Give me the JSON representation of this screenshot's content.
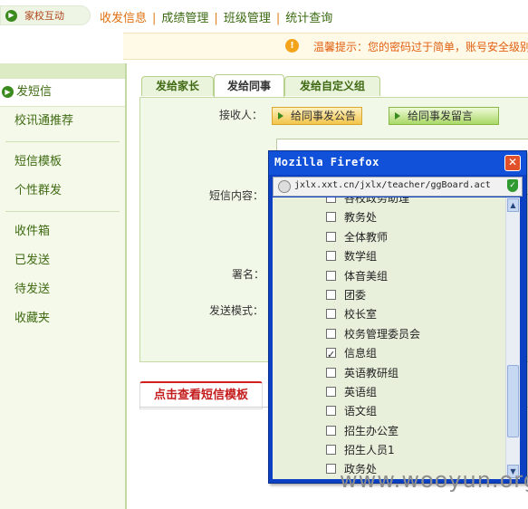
{
  "brand": {
    "label": "家校互动"
  },
  "topnav": [
    {
      "label": "收发信息",
      "active": true
    },
    {
      "label": "成绩管理",
      "active": false
    },
    {
      "label": "班级管理",
      "active": false
    },
    {
      "label": "统计查询",
      "active": false
    }
  ],
  "warning": {
    "text": "温馨提示：您的密码过于简单，账号安全级别"
  },
  "sidebar": {
    "items": [
      {
        "label": "发短信",
        "active": true
      },
      {
        "label": "校讯通推荐"
      },
      {
        "label": "短信模板"
      },
      {
        "label": "个性群发"
      },
      {
        "label": "收件箱"
      },
      {
        "label": "已发送"
      },
      {
        "label": "待发送"
      },
      {
        "label": "收藏夹"
      }
    ]
  },
  "tabs": [
    {
      "label": "发给家长"
    },
    {
      "label": "发给同事",
      "active": true
    },
    {
      "label": "发给自定义组"
    }
  ],
  "form": {
    "recipient_label": "接收人：",
    "btn_notice": "给同事发公告",
    "btn_message": "给同事发留言",
    "content_label": "短信内容：",
    "signature_label": "署名：",
    "send_mode_label": "发送模式："
  },
  "show_template_button": "点击查看短信模板",
  "popup": {
    "title": "Mozilla Firefox",
    "url": "jxlx.xxt.cn/jxlx/teacher/ggBoard.act",
    "items": [
      {
        "label": "各校政务助理",
        "checked": false
      },
      {
        "label": "教务处",
        "checked": false
      },
      {
        "label": "全体教师",
        "checked": false
      },
      {
        "label": "数学组",
        "checked": false
      },
      {
        "label": "体音美组",
        "checked": false
      },
      {
        "label": "团委",
        "checked": false
      },
      {
        "label": "校长室",
        "checked": false
      },
      {
        "label": "校务管理委员会",
        "checked": false
      },
      {
        "label": "信息组",
        "checked": true
      },
      {
        "label": "英语教研组",
        "checked": false
      },
      {
        "label": "英语组",
        "checked": false
      },
      {
        "label": "语文组",
        "checked": false
      },
      {
        "label": "招生办公室",
        "checked": false
      },
      {
        "label": "招生人员1",
        "checked": false
      },
      {
        "label": "政务处",
        "checked": false
      }
    ]
  },
  "watermark": "www.wooyun.org",
  "colors": {
    "accent_green": "#3a8a1e",
    "nav_active": "#e07010",
    "warning_text": "#e06010",
    "popup_title": "#1150d8"
  }
}
